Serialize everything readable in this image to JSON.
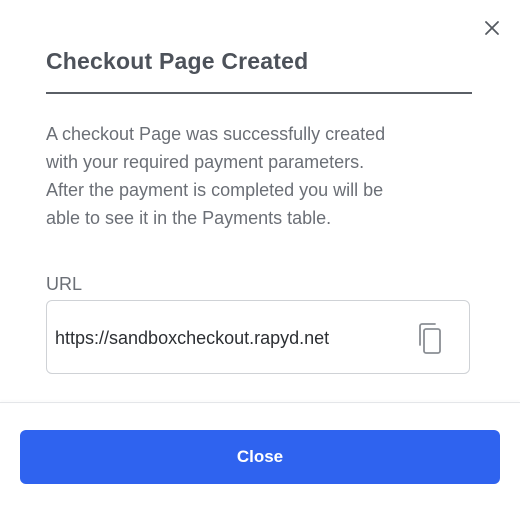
{
  "dialog": {
    "title": "Checkout Page Created",
    "description_lines": [
      "A checkout Page was successfully created",
      "with your required payment parameters.",
      "After the payment is completed you will be",
      "able to see it in the Payments table."
    ],
    "url_label": "URL",
    "url_value": "https://sandboxcheckout.rapyd.net",
    "close_button_label": "Close",
    "icons": {
      "dismiss": "close-icon",
      "copy": "copy-icon"
    }
  },
  "colors": {
    "primary": "#2f63ef",
    "title": "#4d525a",
    "body_text": "#6b6f76"
  }
}
